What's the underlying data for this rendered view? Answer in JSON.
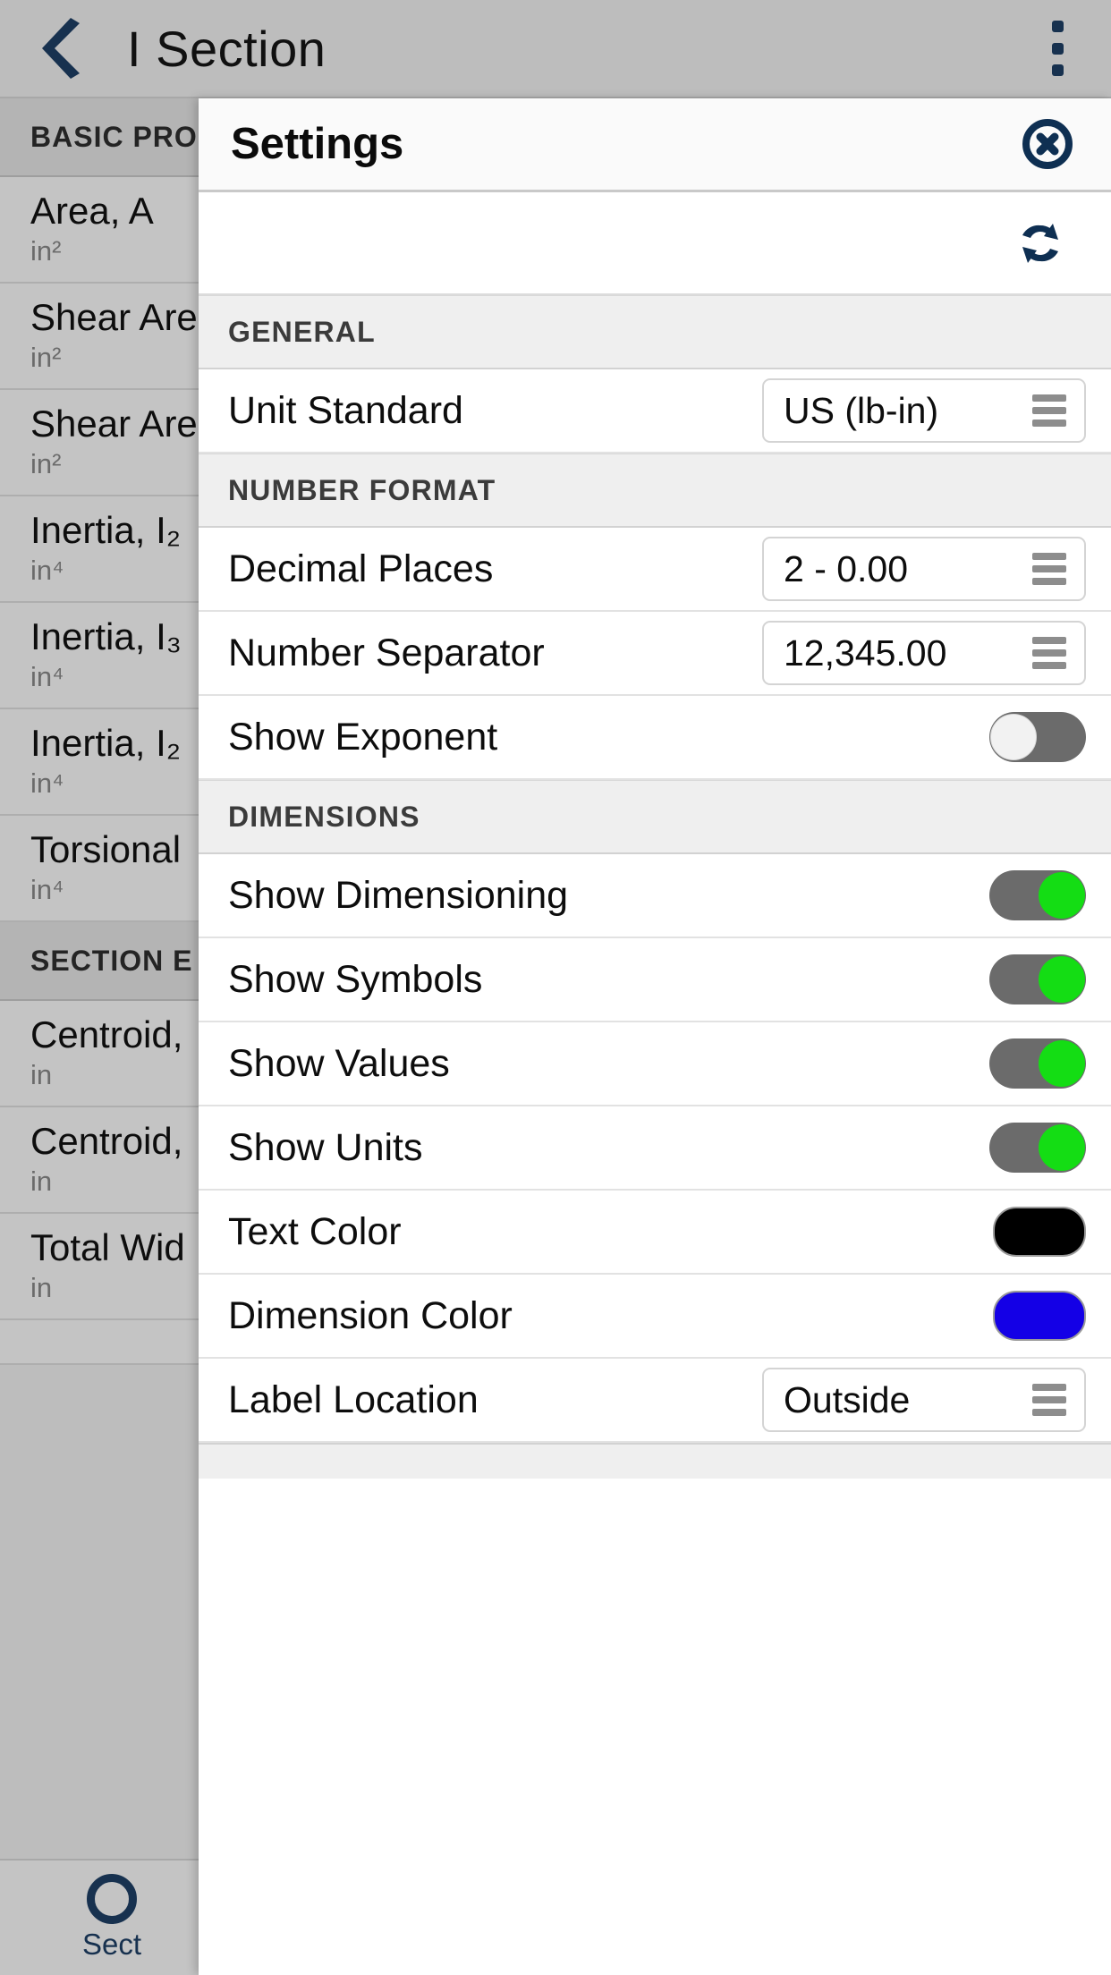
{
  "appbar": {
    "back_icon": "chevron-left-icon",
    "title": "I Section",
    "menu_icon": "overflow-menu-icon"
  },
  "background_list": {
    "sections": [
      {
        "header": "BASIC PROPERTIES",
        "rows": [
          {
            "label": "Area, A",
            "unit": "in²"
          },
          {
            "label": "Shear Area",
            "unit": "in²"
          },
          {
            "label": "Shear Area",
            "unit": "in²"
          },
          {
            "label": "Inertia, I₂",
            "unit": "in⁴"
          },
          {
            "label": "Inertia, I₃",
            "unit": "in⁴"
          },
          {
            "label": "Inertia, I₂",
            "unit": "in⁴"
          },
          {
            "label": "Torsional",
            "unit": "in⁴"
          }
        ]
      },
      {
        "header": "SECTION E",
        "rows": [
          {
            "label": "Centroid,",
            "unit": "in"
          },
          {
            "label": "Centroid,",
            "unit": "in"
          },
          {
            "label": "Total Wid",
            "unit": "in"
          }
        ]
      }
    ],
    "tab": {
      "icon": "section-circle-icon",
      "label": "Sect"
    }
  },
  "settings": {
    "title": "Settings",
    "close_icon": "close-circle-icon",
    "refresh_icon": "refresh-icon",
    "groups": [
      {
        "header": "GENERAL",
        "rows": [
          {
            "label": "Unit Standard",
            "control": "select",
            "value": "US (lb-in)",
            "menu_icon": "hamburger-icon"
          }
        ]
      },
      {
        "header": "NUMBER FORMAT",
        "rows": [
          {
            "label": "Decimal Places",
            "control": "select",
            "value": "2 - 0.00",
            "menu_icon": "hamburger-icon"
          },
          {
            "label": "Number Separator",
            "control": "select",
            "value": "12,345.00",
            "menu_icon": "hamburger-icon"
          },
          {
            "label": "Show Exponent",
            "control": "toggle",
            "state": "off"
          }
        ]
      },
      {
        "header": "DIMENSIONS",
        "rows": [
          {
            "label": "Show Dimensioning",
            "control": "toggle",
            "state": "on"
          },
          {
            "label": "Show Symbols",
            "control": "toggle",
            "state": "on"
          },
          {
            "label": "Show Values",
            "control": "toggle",
            "state": "on"
          },
          {
            "label": "Show Units",
            "control": "toggle",
            "state": "on"
          },
          {
            "label": "Text Color",
            "control": "swatch",
            "color": "#000000"
          },
          {
            "label": "Dimension Color",
            "control": "swatch",
            "color": "#1400e6"
          },
          {
            "label": "Label Location",
            "control": "select",
            "value": "Outside",
            "menu_icon": "hamburger-icon"
          }
        ]
      }
    ]
  },
  "colors": {
    "accent_navy": "#17314f",
    "toggle_on": "#14dd14",
    "toggle_track": "#6b6b6b",
    "app_background": "#bdbdbd"
  }
}
